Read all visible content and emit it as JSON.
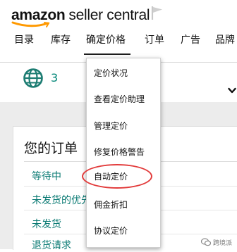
{
  "logo": {
    "amazon": "amazon",
    "rest": "seller central"
  },
  "nav": {
    "items": [
      {
        "label": "目录"
      },
      {
        "label": "库存"
      },
      {
        "label": "确定价格"
      },
      {
        "label": "订单"
      },
      {
        "label": "广告"
      },
      {
        "label": "品牌"
      }
    ]
  },
  "toolbar": {
    "marketplace_count": "3"
  },
  "orders": {
    "title": "您的订单",
    "links": [
      {
        "label": "等待中"
      },
      {
        "label": "未发货的优先"
      },
      {
        "label": "未发货"
      },
      {
        "label": "退货请求"
      }
    ]
  },
  "pricing_menu": {
    "items": [
      {
        "label": "定价状况"
      },
      {
        "label": "查看定价助理"
      },
      {
        "label": "管理定价"
      },
      {
        "label": "修复价格警告"
      },
      {
        "label": "自动定价"
      },
      {
        "label": "佣金折扣"
      },
      {
        "label": "协议定价"
      }
    ],
    "highlighted_index": 4
  },
  "watermark": {
    "text": "跨境派"
  },
  "colors": {
    "link": "#0a7a73",
    "highlight": "#e23b3b",
    "logo_smile": "#f90"
  }
}
